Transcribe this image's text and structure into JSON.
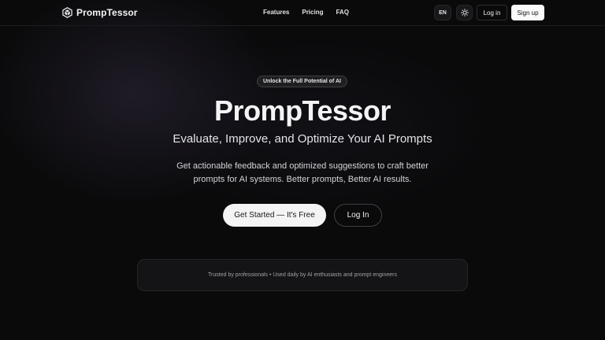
{
  "header": {
    "brand": "PrompTessor",
    "nav": [
      "Features",
      "Pricing",
      "FAQ"
    ],
    "lang": "EN",
    "theme_icon": "sun-icon",
    "login_label": "Log in",
    "signup_label": "Sign up"
  },
  "hero": {
    "badge": "Unlock the Full Potential of AI",
    "title": "PrompTessor",
    "subtitle": "Evaluate, Improve, and Optimize Your AI Prompts",
    "description": "Get actionable feedback and optimized suggestions to craft better prompts for AI systems. Better prompts, Better AI results.",
    "cta_primary": "Get Started — It's Free",
    "cta_secondary": "Log In"
  },
  "trust": {
    "text": "Trusted by professionals • Used daily by AI enthusiasts and prompt engineers"
  },
  "colors": {
    "background": "#0a0a0b",
    "primary_button": "#f4f4f5",
    "border": "#27272a"
  }
}
